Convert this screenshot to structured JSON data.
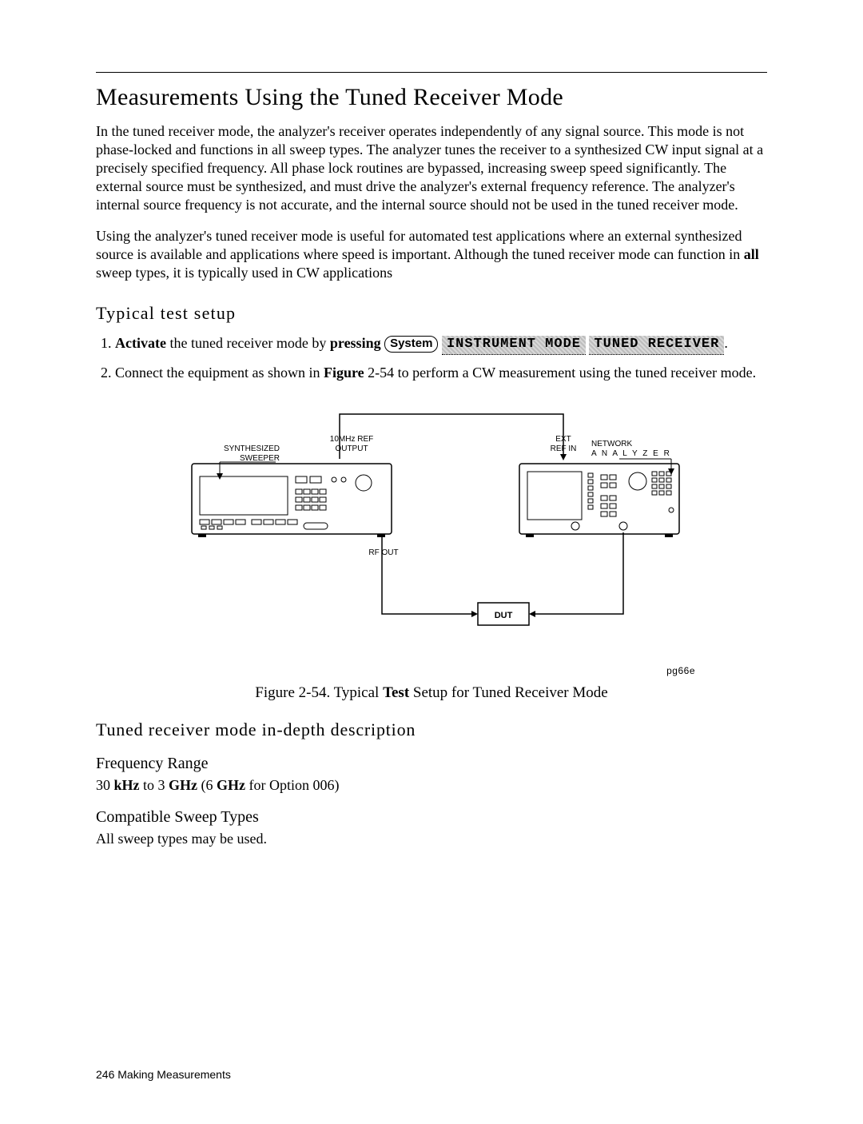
{
  "title": "Measurements Using the Tuned Receiver Mode",
  "para1": "In the tuned receiver mode, the analyzer's receiver operates independently of any signal source. This mode is not phase-locked and functions in all sweep types. The analyzer tunes the receiver to a synthesized CW input signal at a precisely specified frequency. All phase lock routines are bypassed, increasing sweep speed significantly. The external source must be synthesized, and must drive the analyzer's external frequency reference. The analyzer's internal source frequency is not accurate, and the internal source should not be used in the tuned receiver mode.",
  "para2_pre": "Using the analyzer's tuned receiver mode is useful for automated test applications where an external synthesized source is available and applications where speed is important. Although the tuned receiver mode can function in ",
  "para2_bold": "all",
  "para2_post": " sweep types, it is typically used in CW applications",
  "setup_heading": "Typical test setup",
  "step1": {
    "pre": "Activate",
    "mid": " the tuned receiver mode by ",
    "press": "pressing ",
    "key": "System",
    "sk1": "INSTRUMENT MODE",
    "sk2": "TUNED RECEIVER",
    "tail": "."
  },
  "step2": {
    "a": "Connect the equipment as shown in ",
    "b": "Figure",
    "c": " 2-54 to perform a CW measurement using the tuned receiver mode."
  },
  "figure": {
    "labels": {
      "synth": "SYNTHESIZED",
      "sweeper": "SWEEPER",
      "ref_out": "10MHz  REF",
      "output": "OUTPUT",
      "ext": "EXT",
      "ref_in": "REF  IN",
      "network": "NETWORK",
      "analyzer": "A N A L Y Z E R",
      "rf_out": "RF  OUT",
      "dut": "DUT"
    },
    "id": "pg66e",
    "caption_pre": "Figure 2-54. Typical ",
    "caption_bold": "Test",
    "caption_post": " Setup for Tuned Receiver Mode"
  },
  "indepth_heading": "Tuned receiver mode in-depth description",
  "freq": {
    "head": "Frequency Range",
    "a": "30 ",
    "b": "kHz",
    "c": " to 3 ",
    "d": "GHz",
    "e": " (6 ",
    "f": "GHz",
    "g": " for Option 006)"
  },
  "sweep": {
    "head": "Compatible Sweep Types",
    "body": "All sweep types may be used."
  },
  "footer": "246 Making Measurements"
}
